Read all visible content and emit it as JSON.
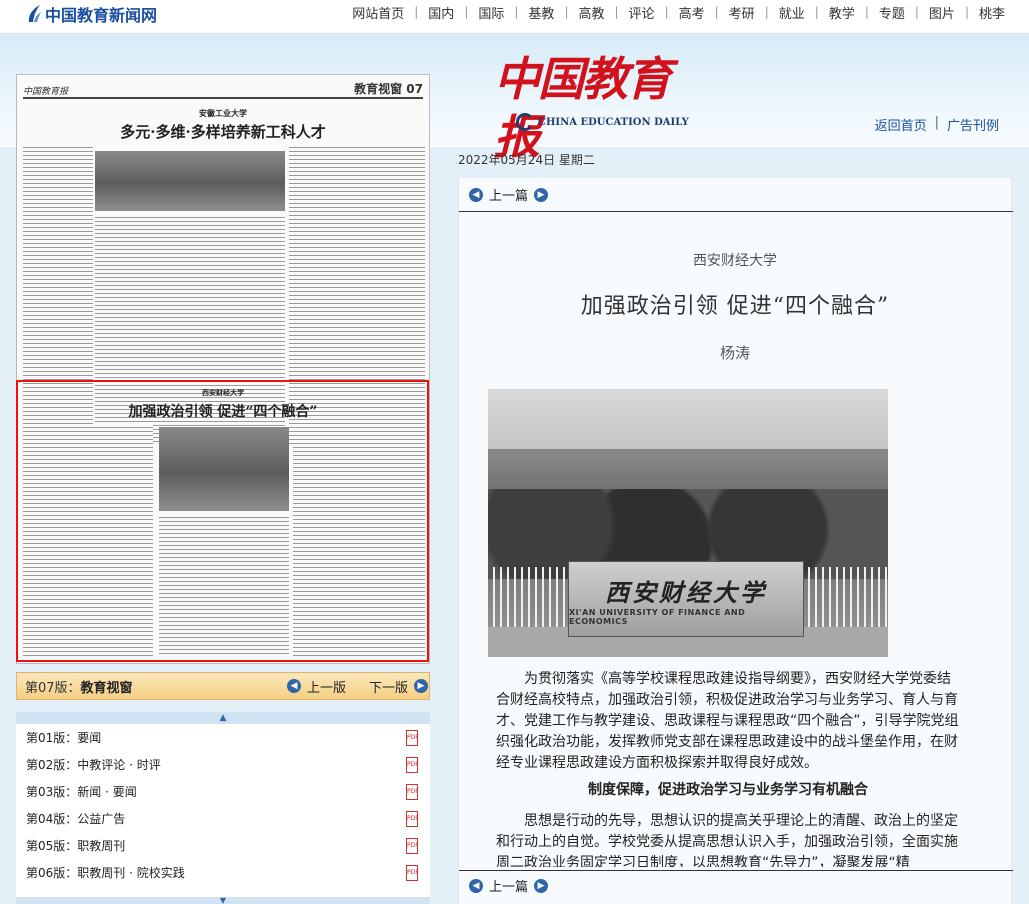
{
  "site": {
    "logo_text": "中国教育新闻网"
  },
  "topnav": {
    "items": [
      "网站首页",
      "国内",
      "国际",
      "基教",
      "高教",
      "评论",
      "高考",
      "考研",
      "就业",
      "教学",
      "专题",
      "图片",
      "桃李"
    ]
  },
  "masthead": {
    "title_cn": "中国教育报",
    "title_en": "CHINA EDUCATION DAILY"
  },
  "header_links": {
    "home": "返回首页",
    "ads": "广告刊例"
  },
  "date_line": "2022年05月24日  星期二",
  "thumbnail": {
    "page_label": "教育视窗",
    "page_num": "07",
    "top_org": "安徽工业大学",
    "top_title": "多元·多维·多样培养新工科人才",
    "mid_org": "西安财经大学",
    "mid_title": "加强政治引领  促进“四个融合”"
  },
  "pagebar": {
    "current": "第07版：",
    "current_name": "教育视窗",
    "prev": "上一版",
    "next": "下一版"
  },
  "page_list": [
    {
      "num": "第01版：",
      "name": "要闻"
    },
    {
      "num": "第02版：",
      "name": "中教评论 · 时评"
    },
    {
      "num": "第03版：",
      "name": "新闻 · 要闻"
    },
    {
      "num": "第04版：",
      "name": "公益广告"
    },
    {
      "num": "第05版：",
      "name": "职教周刊"
    },
    {
      "num": "第06版：",
      "name": "职教周刊 · 院校实践"
    }
  ],
  "article": {
    "nav_prev": "上一篇",
    "org": "西安财经大学",
    "title": "加强政治引领  促进“四个融合”",
    "author": "杨涛",
    "photo_sign": "西安财经大学",
    "photo_sign_en": "XI'AN UNIVERSITY OF FINANCE AND ECONOMICS",
    "para1": "为贯彻落实《高等学校课程思政建设指导纲要》，西安财经大学党委结合财经高校特点，加强政治引领，积极促进政治学习与业务学习、育人与育才、党建工作与教学建设、思政课程与课程思政“四个融合”，引导学院党组织强化政治功能，发挥教师党支部在课程思政建设中的战斗堡垒作用，在财经专业课程思政建设方面积极探索并取得良好成效。",
    "section1": "制度保障，促进政治学习与业务学习有机融合",
    "para2": "思想是行动的先导，思想认识的提高关乎理论上的清醒、政治上的坚定和行动上的自觉。学校党委从提高思想认识入手，加强政治引领，全面实施周二政治业务固定学习日制度，以思想教育“先导力”，凝聚发展“精"
  }
}
